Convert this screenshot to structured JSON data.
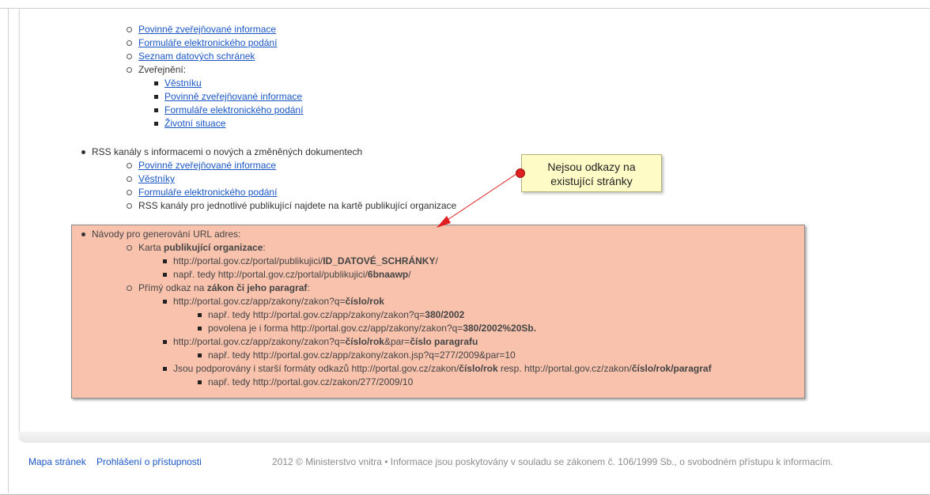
{
  "colors": {
    "link": "#1a56c6",
    "callout_bg": "#fffbc6",
    "highlight_bg": "#f9c2ad",
    "arrow": "#e02020",
    "footer_text": "#8c8c8c"
  },
  "block1": {
    "items": [
      "Povinně zveřejňované informace",
      "Formuláře elektronického podání",
      "Seznam datových schránek"
    ],
    "published_label": "Zveřejnění:",
    "published_items": [
      "Věstníku",
      "Povinně zveřejňované informace",
      "Formuláře elektronického podání",
      "Životní situace"
    ]
  },
  "rss": {
    "heading": "RSS kanály s informacemi o nových a změněných dokumentech",
    "links": [
      "Povinně zveřejňované informace",
      "Věstníky",
      "Formuláře elektronického podání"
    ],
    "note": "RSS kanály pro jednotlivé publikující najdete na kartě publikující organizace"
  },
  "callout": {
    "line1": "Nejsou odkazy na",
    "line2": "existující stránky"
  },
  "guide": {
    "heading": "Návody pro generování URL adres:",
    "card": {
      "prefix": "Karta ",
      "bold": "publikující organizace",
      "suffix": ":",
      "url_prefix": "http://portal.gov.cz/portal/publikujici/",
      "url_bold": "ID_DATOVÉ_SCHRÁNKY",
      "url_suffix": "/",
      "example_prefix": "např. tedy http://portal.gov.cz/portal/publikujici/",
      "example_bold": "6bnaawp",
      "example_suffix": "/"
    },
    "law": {
      "prefix": "Přímý odkaz na ",
      "bold": "zákon či jeho paragraf",
      "suffix": ":",
      "url1_prefix": "http://portal.gov.cz/app/zakony/zakon?q=",
      "url1_bold": "číslo/rok",
      "url1_ex1_prefix": "např. tedy http://portal.gov.cz/app/zakony/zakon?q=",
      "url1_ex1_bold": "380/2002",
      "url1_ex2_prefix": "povolena je i forma http://portal.gov.cz/app/zakony/zakon?q=",
      "url1_ex2_bold": "380/2002%20Sb.",
      "url2_prefix": "http://portal.gov.cz/app/zakony/zakon?q=",
      "url2_bold1": "číslo/rok",
      "url2_mid": "&par=",
      "url2_bold2": "číslo paragrafu",
      "url2_ex": "např. tedy http://portal.gov.cz/app/zakony/zakon.jsp?q=277/2009&par=10",
      "old_prefix": "Jsou podporovány i starší formáty odkazů http://portal.gov.cz/zakon/",
      "old_bold1": "číslo/rok",
      "old_mid": " resp. http://portal.gov.cz/zakon/",
      "old_bold2": "číslo/rok/paragraf",
      "old_ex": "např. tedy http://portal.gov.cz/zakon/277/2009/10"
    }
  },
  "footer": {
    "sitemap": "Mapa stránek",
    "accessibility": "Prohlášení o přístupnosti",
    "copyright": "2012 © Ministerstvo vnitra • Informace jsou poskytovány v souladu se zákonem č. 106/1999 Sb., o svobodném přístupu k informacím."
  }
}
